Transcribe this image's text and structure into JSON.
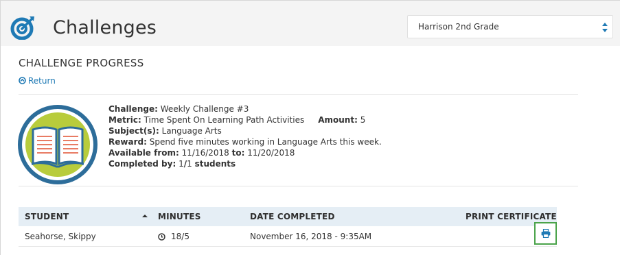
{
  "header": {
    "title": "Challenges",
    "class_select": {
      "value": "Harrison 2nd Grade"
    }
  },
  "section": {
    "title": "CHALLENGE PROGRESS",
    "return_label": "Return"
  },
  "challenge": {
    "challenge_label": "Challenge:",
    "challenge_value": "Weekly Challenge #3",
    "metric_label": "Metric:",
    "metric_value": "Time Spent On Learning Path Activities",
    "amount_label": "Amount:",
    "amount_value": "5",
    "subjects_label": "Subject(s):",
    "subjects_value": "Language Arts",
    "reward_label": "Reward:",
    "reward_value": "Spend five minutes working in Language Arts this week.",
    "available_label": "Available from:",
    "available_from": "11/16/2018",
    "to_label": "to:",
    "available_to": "11/20/2018",
    "completed_label": "Completed by:",
    "completed_count": "1",
    "completed_sep": "/",
    "completed_total": "1",
    "completed_unit": "students"
  },
  "table": {
    "columns": [
      "STUDENT",
      "MINUTES",
      "DATE COMPLETED",
      "PRINT CERTIFICATE"
    ],
    "rows": [
      {
        "student": "Seahorse, Skippy",
        "minutes": "18/5",
        "date_completed": "November 16, 2018 - 9:35AM"
      }
    ]
  },
  "icons": {
    "logo": "target-icon",
    "return": "circle-arrow-up-icon",
    "sort": "sort-up-icon",
    "minutes": "clock-icon",
    "print": "printer-icon",
    "badge": "open-book-icon"
  },
  "colors": {
    "accent": "#1f7ab5",
    "header_bg": "#f4f4f4",
    "table_header_bg": "#e5eef5",
    "badge_green": "#b8cc3c",
    "badge_ring": "#2d6d9a",
    "highlight": "#4aa34a"
  }
}
